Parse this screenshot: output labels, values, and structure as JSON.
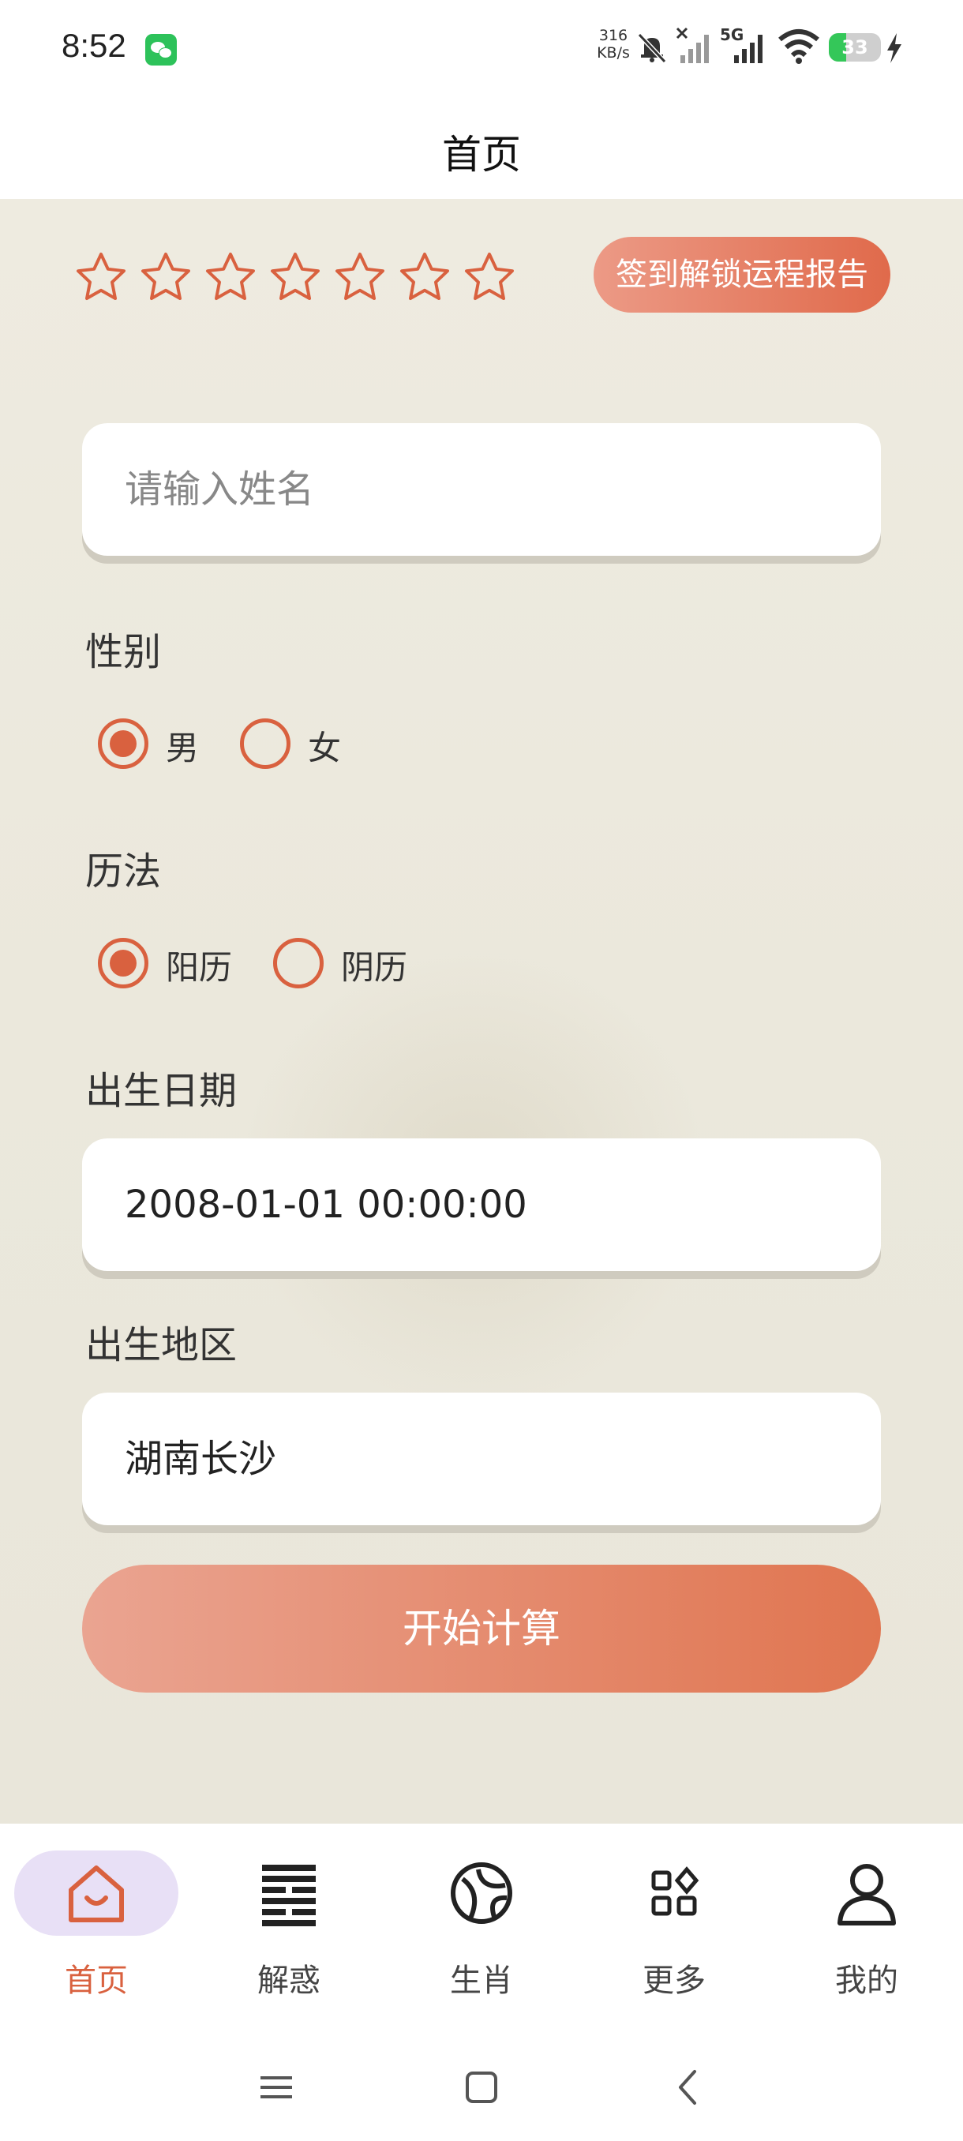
{
  "status_bar": {
    "time": "8:52",
    "net_speed_value": "316",
    "net_speed_unit": "KB/s",
    "network": "5G",
    "battery": "33",
    "battery_level": 0.33,
    "icons": [
      "wechat-icon",
      "bell-muted-icon",
      "signal-x-icon",
      "signal-5g-icon",
      "wifi-icon",
      "battery-icon",
      "charging-icon"
    ]
  },
  "header": {
    "title": "首页"
  },
  "checkin": {
    "stars": 7,
    "button_label": "签到解锁运程报告"
  },
  "form": {
    "name_placeholder": "请输入姓名",
    "gender_label": "性别",
    "gender_options": [
      "男",
      "女"
    ],
    "gender_selected": "男",
    "calendar_label": "历法",
    "calendar_options": [
      "阳历",
      "阴历"
    ],
    "calendar_selected": "阳历",
    "birth_date_label": "出生日期",
    "birth_date_value": "2008-01-01 00:00:00",
    "birth_place_label": "出生地区",
    "birth_place_value": "湖南长沙",
    "submit_label": "开始计算"
  },
  "bottom_nav": {
    "items": [
      {
        "label": "首页",
        "icon": "home-icon",
        "active": true
      },
      {
        "label": "解惑",
        "icon": "hexagram-icon",
        "active": false
      },
      {
        "label": "生肖",
        "icon": "zodiac-icon",
        "active": false
      },
      {
        "label": "更多",
        "icon": "grid-icon",
        "active": false
      },
      {
        "label": "我的",
        "icon": "user-icon",
        "active": false
      }
    ]
  },
  "colors": {
    "accent": "#d9613f",
    "active_pill": "#e8e0f6",
    "background": "#ebe8dc"
  }
}
